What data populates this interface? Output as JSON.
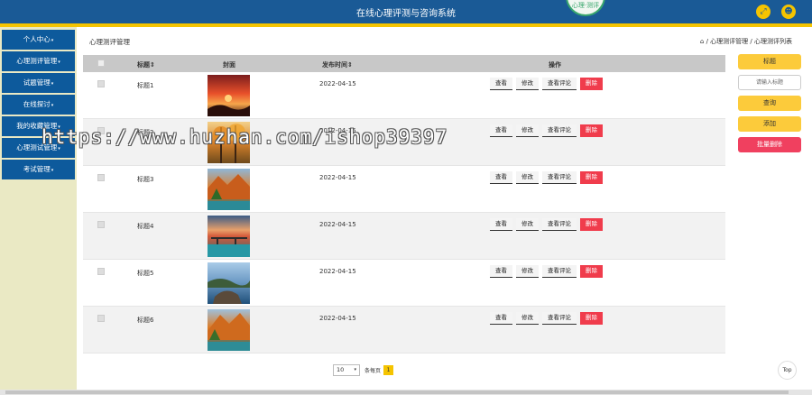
{
  "app": {
    "title": "在线心理评测与咨询系统",
    "logo_text": "心理·测评"
  },
  "header": {
    "fullscreen_icon": "expand-icon",
    "user_icon": "user-icon"
  },
  "sidebar": {
    "items": [
      {
        "label": "个人中心"
      },
      {
        "label": "心理测评管理"
      },
      {
        "label": "试题管理"
      },
      {
        "label": "在线探讨"
      },
      {
        "label": "我的收藏管理"
      },
      {
        "label": "心理测试管理"
      },
      {
        "label": "考试管理"
      }
    ]
  },
  "breadcrumb": {
    "left": "心理测评管理",
    "home_icon": "home-icon",
    "path": "/ 心理测评管理 / 心理测评列表"
  },
  "table": {
    "headers": {
      "title": "标题⇕",
      "cover": "封面",
      "date": "发布时间⇕",
      "ops": "操作"
    },
    "ops": {
      "view": "查看",
      "edit": "修改",
      "comments": "查看评论",
      "delete": "删除"
    },
    "rows": [
      {
        "title": "标题1",
        "date": "2022-04-15"
      },
      {
        "title": "标题2",
        "date": "2022-04-15"
      },
      {
        "title": "标题3",
        "date": "2022-04-15"
      },
      {
        "title": "标题4",
        "date": "2022-04-15"
      },
      {
        "title": "标题5",
        "date": "2022-04-15"
      },
      {
        "title": "标题6",
        "date": "2022-04-15"
      }
    ]
  },
  "pager": {
    "page_size": "10",
    "per_page_label": "条每页",
    "current_page": "1"
  },
  "right_panel": {
    "field_label": "标题",
    "input_placeholder": "请输入标题",
    "search": "查询",
    "add": "添加",
    "batch_delete": "批量删除"
  },
  "top_button": "Top",
  "watermark": "https://www.huzhan.com/ishop39397",
  "colors": {
    "header": "#1a5a96",
    "accent": "#f5c400",
    "sidebar_bg": "#eae9c4",
    "danger": "#f03c4c"
  }
}
